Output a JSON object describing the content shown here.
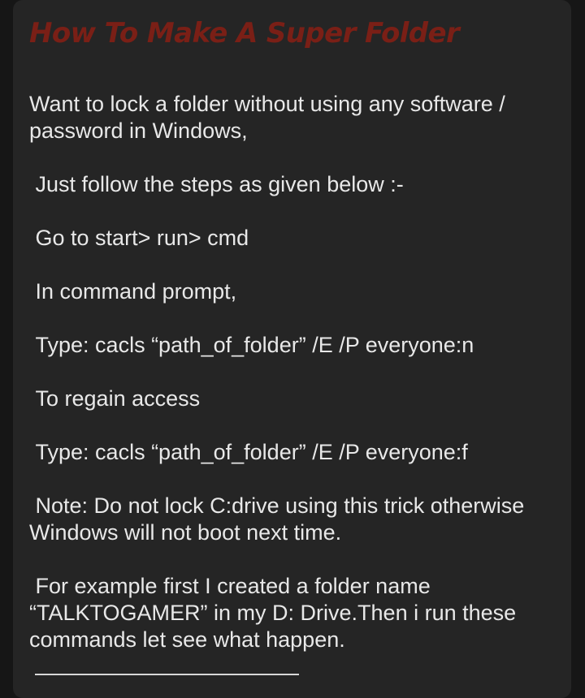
{
  "article": {
    "title": "How To Make A Super Folder",
    "paragraphs": [
      "Want to lock a folder without using any software / password in Windows,",
      " Just follow the steps as given below :-",
      " Go to start> run> cmd",
      " In command prompt,",
      " Type: cacls “path_of_folder” /E /P everyone:n",
      " To regain access",
      " Type: cacls “path_of_folder” /E /P everyone:f",
      " Note: Do not lock C:drive using this trick otherwise Windows will not boot next time.",
      " For example first I created a folder name “TALKTOGAMER” in my D: Drive.Then i run these commands let see what happen."
    ]
  },
  "colors": {
    "background": "#161616",
    "card": "#252525",
    "title": "#7a1f16",
    "text": "#e8e8e8"
  }
}
